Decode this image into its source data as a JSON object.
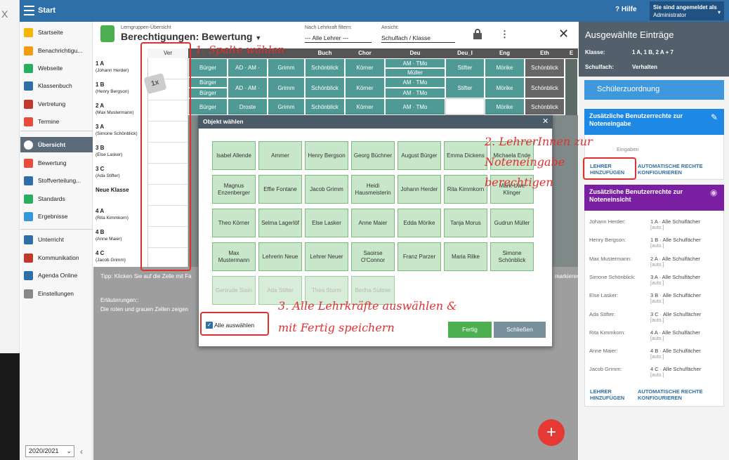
{
  "topbar": {
    "start_label": "Start",
    "help_label": "Hilfe",
    "user_line1": "Sie sind angemeldet als",
    "user_line2": "Administrator"
  },
  "sidebar": {
    "items": [
      {
        "label": "Startseite",
        "color": "#f5b500"
      },
      {
        "label": "Benachrichtigu...",
        "color": "#f39c12"
      },
      {
        "label": "Webseite",
        "color": "#27ae60"
      },
      {
        "label": "Klassenbuch",
        "color": "#2e6fa8"
      },
      {
        "label": "Vertretung",
        "color": "#c0392b"
      },
      {
        "label": "Termine",
        "color": "#e74c3c"
      },
      {
        "label": "Übersicht",
        "color": "#ffffff"
      },
      {
        "label": "Bewertung",
        "color": "#e74c3c"
      },
      {
        "label": "Stoffverteilung...",
        "color": "#2e6fa8"
      },
      {
        "label": "Standards",
        "color": "#27ae60"
      },
      {
        "label": "Ergebnisse",
        "color": "#3498db"
      },
      {
        "label": "Unterricht",
        "color": "#2e6fa8"
      },
      {
        "label": "Kommunikation",
        "color": "#c0392b"
      },
      {
        "label": "Agenda Online",
        "color": "#2e6fa8"
      },
      {
        "label": "Einstellungen",
        "color": "#888888"
      }
    ],
    "year": "2020/2021"
  },
  "header": {
    "subtitle": "Lerngruppen-Übersicht",
    "title": "Berechtigungen: Bewertung",
    "filter_label": "Nach Lehrkraft filtern:",
    "filter_value": "--- Alle Lehrer ---",
    "view_label": "Ansicht:",
    "view_value": "Schulfach / Klasse"
  },
  "grid": {
    "columns": [
      "Ver",
      "Buch",
      "Chor",
      "Deu",
      "Deu_I",
      "Eng",
      "Eth",
      "E"
    ],
    "rows": [
      {
        "class": "1 A",
        "teacher": "(Johann Herder)"
      },
      {
        "class": "1 B",
        "teacher": "(Henry Bergson)"
      },
      {
        "class": "2 A",
        "teacher": "(Max Mustermann)"
      },
      {
        "class": "3 A",
        "teacher": "(Simone Schönblick)"
      },
      {
        "class": "3 B",
        "teacher": "(Else Lasker)"
      },
      {
        "class": "3 C",
        "teacher": "(Ada Stifter)"
      },
      {
        "class": "Neue Klasse",
        "teacher": ""
      },
      {
        "class": "4 A",
        "teacher": "(Rita Kimmkorn)"
      },
      {
        "class": "4 B",
        "teacher": "(Anne Maier)"
      },
      {
        "class": "4 C",
        "teacher": "(Jacob Grimm)"
      }
    ],
    "cells": {
      "r1": [
        "Bürger",
        "AD · AM ·",
        "Grimm",
        "Schönblick",
        "Körner",
        "AM · TMo",
        "Stifter",
        "Mörike",
        "Schönblick"
      ],
      "r1b": "Müller",
      "r2": [
        "Bürger",
        "AD · AM ·",
        "Grimm",
        "Schönblick",
        "Körner",
        "AM · TMo",
        "Stifter",
        "Mörike",
        "Schönblick"
      ],
      "r2a": "Bürger",
      "r2b": "AM · TMo",
      "r3": [
        "Bürger",
        "Droste",
        "Grimm",
        "Schönblick",
        "Körner",
        "AM · TMo",
        "",
        "Mörike",
        "Schönblick"
      ]
    }
  },
  "bottom": {
    "tip": "Tipp: Klicken Sie auf die Zelle mit Fa",
    "tip_right": "markieren",
    "explain_title": "Erläuterungen::",
    "explain_text": "Die roten und grauen Zellen zeigen"
  },
  "dialog": {
    "title": "Objekt wählen",
    "tiles": [
      "Isabel Allende",
      "Ammer",
      "Henry Bergson",
      "Georg Büchner",
      "August Bürger",
      "Emma Dickens",
      "Michaela Ende",
      "Magnus Enzenberger",
      "Effie Fontane",
      "Jacob Grimm",
      "Heidi Hausmeisterin",
      "Johann Herder",
      "Rita Kimmkorn",
      "Mark-Uwe Klinger",
      "Theo Körner",
      "Selma Lagerlöf",
      "Else Lasker",
      "Anne Maier",
      "Edda Mörike",
      "Tanja Morus",
      "Gudrun Müller",
      "Max Mustermann",
      "Lehrerin Neue",
      "Lehrer Neuer",
      "Saoirse O'Connor",
      "Franz Parzer",
      "Maria Rilke",
      "Simone Schönblick",
      "Gertrude Stein",
      "Ada Stifter",
      "Thea Storm",
      "Bertha Suttner"
    ],
    "select_all_label": "Alle auswählen",
    "ok_label": "Fertig",
    "close_label": "Schließen"
  },
  "right_panel": {
    "title": "Ausgewählte Einträge",
    "klasse_label": "Klasse:",
    "klasse_value": "1 A, 1 B, 2 A + 7",
    "fach_label": "Schulfach:",
    "fach_value": "Verhalten",
    "assign_button": "Schülerzuordnung",
    "card1_title": "Zusätzliche Benutzerrechte zur Noteneingabe",
    "card1_text": "Eingaben",
    "card1_color": "#1e88e5",
    "add_teacher": "LEHRER HINZUFÜGEN",
    "auto_rights": "AUTOMATISCHE RECHTE KONFIGURIEREN",
    "card2_title": "Zusätzliche Benutzerrechte zur Noteneinsicht",
    "card2_color": "#7b1fa2",
    "entries": [
      {
        "name": "Johann Herder:",
        "value": "1 A · Alle Schulfächer",
        "auto": "[auto.]"
      },
      {
        "name": "Henry Bergson:",
        "value": "1 B · Alle Schulfächer",
        "auto": "[auto.]"
      },
      {
        "name": "Max Mustermann:",
        "value": "2 A · Alle Schulfächer",
        "auto": "[auto.]"
      },
      {
        "name": "Simone Schönblick:",
        "value": "3 A · Alle Schulfächer",
        "auto": "[auto.]"
      },
      {
        "name": "Else Lasker:",
        "value": "3 B · Alle Schulfächer",
        "auto": "[auto.]"
      },
      {
        "name": "Ada Stifter:",
        "value": "3 C · Alle Schulfächer",
        "auto": "[auto.]"
      },
      {
        "name": "Rita Kimmkorn:",
        "value": "4 A · Alle Schulfächer",
        "auto": "[auto.]"
      },
      {
        "name": "Anne Maier:",
        "value": "4 B · Alle Schulfächer",
        "auto": "[auto.]"
      },
      {
        "name": "Jacob Grimm:",
        "value": "4 C · Alle Schulfächer",
        "auto": "[auto.]"
      }
    ]
  },
  "annotations": {
    "a1": "1. Spalte wählen",
    "a2_1": "2. LehrerInnen zur",
    "a2_2": "Noteneingabe",
    "a2_3": "berechtigen",
    "a3_1": "3. Alle Lehrkräfte auswählen &",
    "a3_2": "mit Fertig speichern",
    "click_badge": "1x"
  }
}
